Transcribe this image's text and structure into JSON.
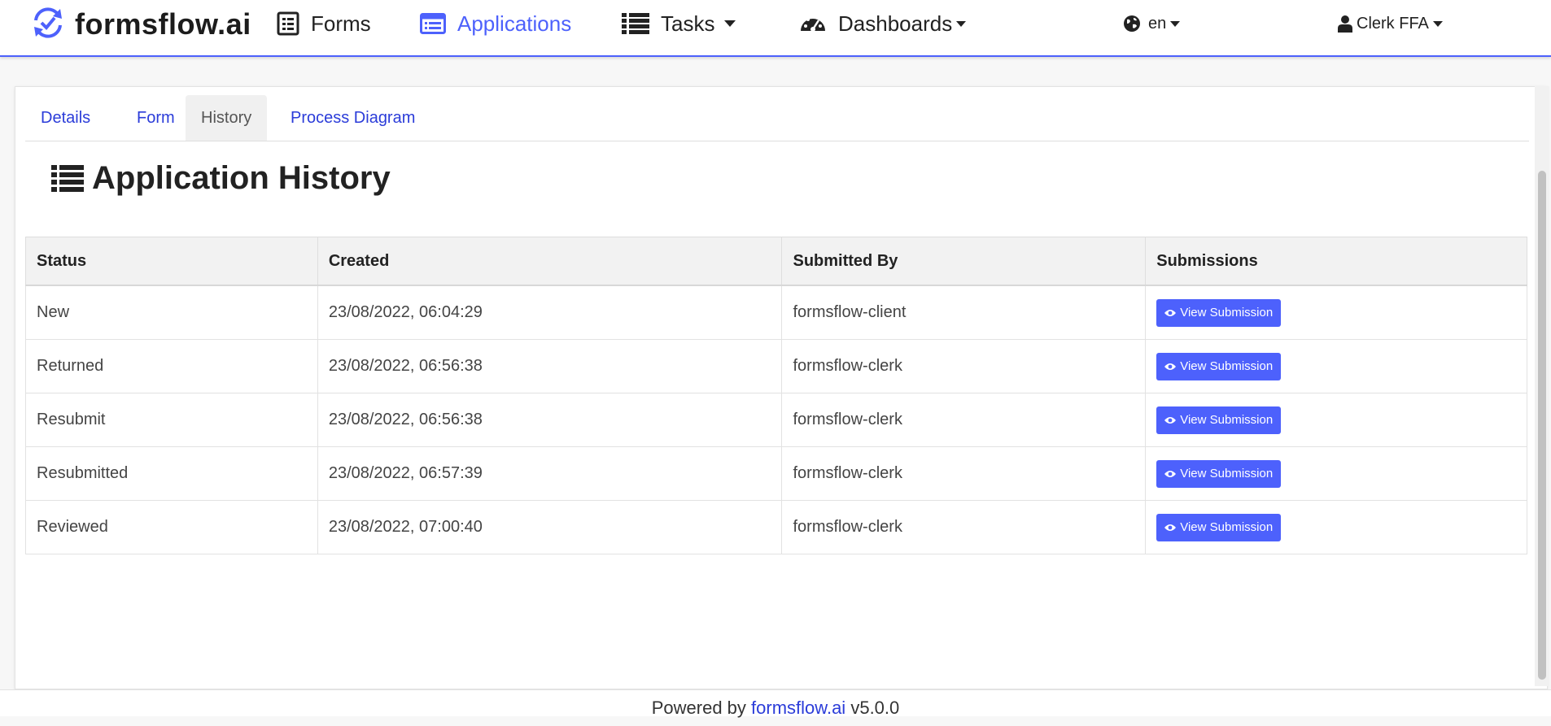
{
  "brand": {
    "name": "formsflow.ai",
    "accent": "#4d61fc"
  },
  "nav": {
    "forms": "Forms",
    "applications": "Applications",
    "tasks": "Tasks",
    "dashboards": "Dashboards",
    "language": "en",
    "user": "Clerk FFA",
    "active": "applications"
  },
  "tabs": [
    {
      "label": "Details",
      "active": false
    },
    {
      "label": "Form",
      "active": false
    },
    {
      "label": "History",
      "active": true
    },
    {
      "label": "Process Diagram",
      "active": false
    }
  ],
  "page_title": "Application History",
  "table": {
    "headers": [
      "Status",
      "Created",
      "Submitted By",
      "Submissions"
    ],
    "rows": [
      {
        "status": "New",
        "created": "23/08/2022, 06:04:29",
        "submitted_by": "formsflow-client",
        "action": "View Submission"
      },
      {
        "status": "Returned",
        "created": "23/08/2022, 06:56:38",
        "submitted_by": "formsflow-clerk",
        "action": "View Submission"
      },
      {
        "status": "Resubmit",
        "created": "23/08/2022, 06:56:38",
        "submitted_by": "formsflow-clerk",
        "action": "View Submission"
      },
      {
        "status": "Resubmitted",
        "created": "23/08/2022, 06:57:39",
        "submitted_by": "formsflow-clerk",
        "action": "View Submission"
      },
      {
        "status": "Reviewed",
        "created": "23/08/2022, 07:00:40",
        "submitted_by": "formsflow-clerk",
        "action": "View Submission"
      }
    ]
  },
  "footer": {
    "prefix": "Powered by",
    "link": "formsflow.ai",
    "version": "v5.0.0"
  }
}
